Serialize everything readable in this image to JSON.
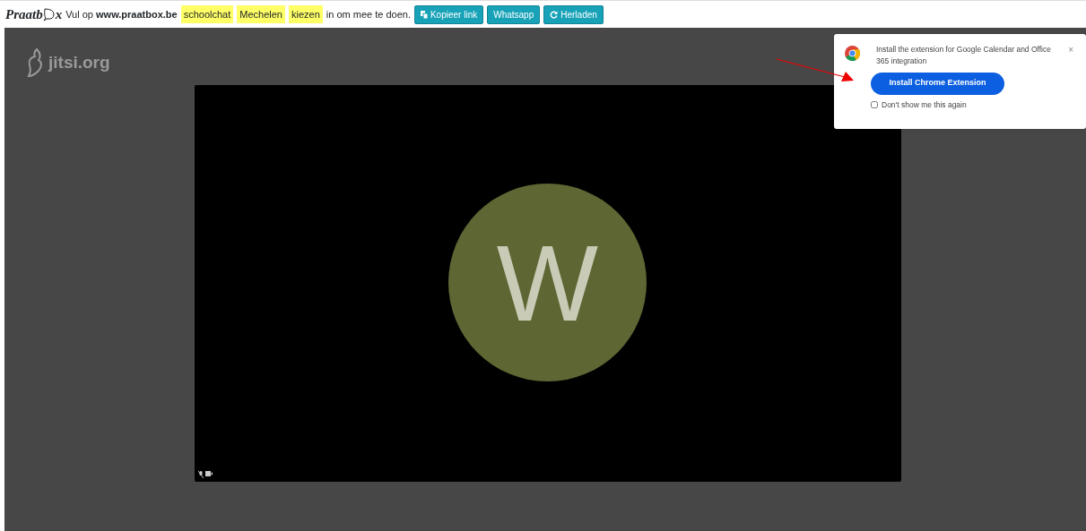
{
  "topbar": {
    "logo": {
      "left": "Praatb",
      "right": "x"
    },
    "instruction": {
      "before": "Vul op",
      "site": "www.praatbox.be",
      "after": "in om mee te doen."
    },
    "tags": [
      "schoolchat",
      "Mechelen",
      "kiezen"
    ],
    "buttons": [
      {
        "label": "Kopieer link",
        "kind": "copy"
      },
      {
        "label": "Whatsapp",
        "kind": "plain"
      },
      {
        "label": "Herladen",
        "kind": "reload"
      }
    ]
  },
  "meeting": {
    "brand": "jitsi.org",
    "avatar_initial": "W"
  },
  "popup": {
    "message": "Install the extension for Google Calendar and Office 365 integration",
    "close": "×",
    "button": "Install Chrome Extension",
    "checkbox": {
      "label": "Don't show me this again",
      "checked": false
    }
  }
}
